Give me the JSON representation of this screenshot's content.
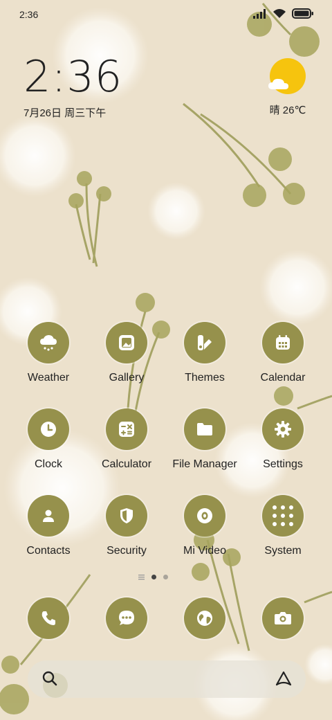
{
  "status_bar": {
    "time": "2:36"
  },
  "clock_widget": {
    "time": "2:36",
    "date": "7月26日 周三下午"
  },
  "weather_widget": {
    "text": "晴 26℃"
  },
  "apps": [
    {
      "label": "Weather",
      "icon": "weather-icon"
    },
    {
      "label": "Gallery",
      "icon": "gallery-icon"
    },
    {
      "label": "Themes",
      "icon": "themes-icon"
    },
    {
      "label": "Calendar",
      "icon": "calendar-icon"
    },
    {
      "label": "Clock",
      "icon": "clock-icon"
    },
    {
      "label": "Calculator",
      "icon": "calculator-icon"
    },
    {
      "label": "File Manager",
      "icon": "folder-icon"
    },
    {
      "label": "Settings",
      "icon": "gear-icon"
    },
    {
      "label": "Contacts",
      "icon": "person-icon"
    },
    {
      "label": "Security",
      "icon": "shield-icon"
    },
    {
      "label": "Mi Video",
      "icon": "video-icon"
    },
    {
      "label": "System",
      "icon": "folder-grid-icon"
    }
  ],
  "page_indicator": {
    "pages": 2,
    "active": 0
  },
  "dock": [
    {
      "icon": "phone-icon"
    },
    {
      "icon": "message-icon"
    },
    {
      "icon": "browser-icon"
    },
    {
      "icon": "camera-icon"
    }
  ],
  "colors": {
    "app_icon_bg": "#96914c",
    "sun": "#f6c40e",
    "wallpaper": "#ece1cc"
  }
}
